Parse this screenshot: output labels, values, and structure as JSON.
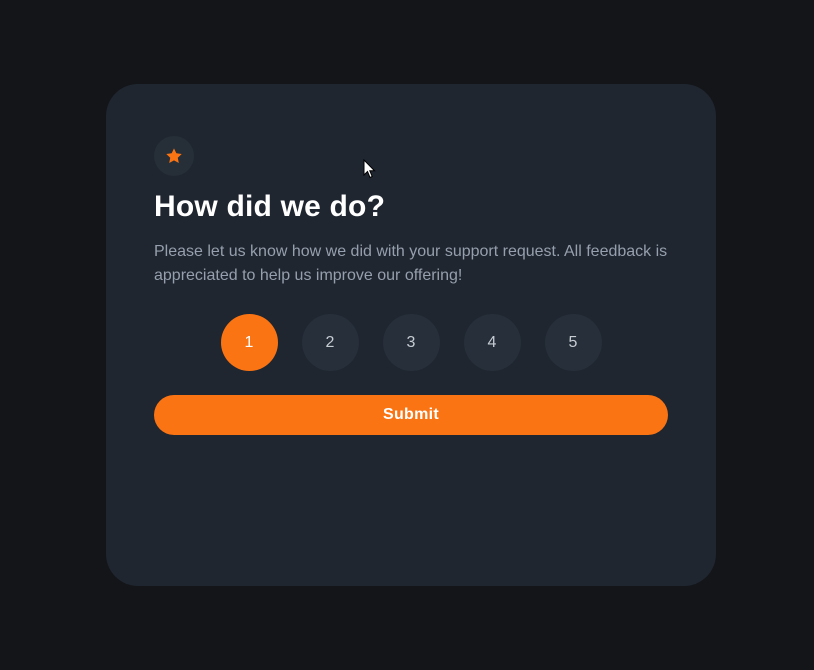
{
  "card": {
    "title": "How did we do?",
    "description": "Please let us know how we did with your support request. All feedback is appreciated to help us improve our offering!",
    "icon": "star-icon"
  },
  "ratings": {
    "options": [
      "1",
      "2",
      "3",
      "4",
      "5"
    ],
    "selected": "1"
  },
  "submit_label": "Submit",
  "colors": {
    "background": "#131518",
    "card": "#1f2630",
    "accent": "#fb7413",
    "rating_bg": "#262f3a",
    "text_muted": "#969fad"
  }
}
